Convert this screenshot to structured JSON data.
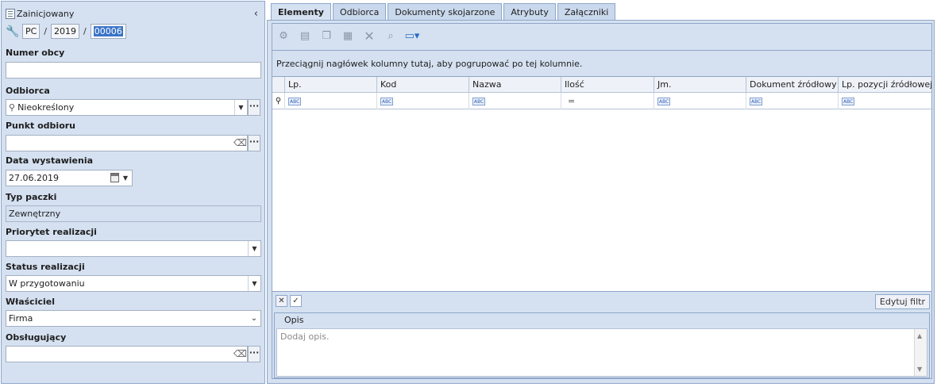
{
  "header": {
    "status": "Zainicjowany",
    "collapse_glyph": "‹",
    "number": {
      "prefix": "PC",
      "year": "2019",
      "seq": "00006",
      "sep": "/"
    }
  },
  "fields": {
    "numer_obcy": {
      "label": "Numer obcy",
      "value": ""
    },
    "odbiorca": {
      "label": "Odbiorca",
      "value": "Nieokreślony"
    },
    "punkt_odbioru": {
      "label": "Punkt odbioru",
      "value": ""
    },
    "data_wystawienia": {
      "label": "Data wystawienia",
      "value": "27.06.2019"
    },
    "typ_paczki": {
      "label": "Typ paczki",
      "value": "Zewnętrzny"
    },
    "priorytet": {
      "label": "Priorytet realizacji",
      "value": ""
    },
    "status_realizacji": {
      "label": "Status realizacji",
      "value": "W przygotowaniu"
    },
    "wlasciciel": {
      "label": "Właściciel",
      "value": "Firma"
    },
    "obslugujacy": {
      "label": "Obsługujący",
      "value": ""
    }
  },
  "tabs": [
    "Elementy",
    "Odbiorca",
    "Dokumenty skojarzone",
    "Atrybuty",
    "Załączniki"
  ],
  "active_tab": "Elementy",
  "toolbar_icons": [
    "add-item-icon",
    "edit-item-icon",
    "copy-item-icon",
    "paste-item-icon",
    "delete-icon",
    "search-icon",
    "export-icon"
  ],
  "grid": {
    "group_hint": "Przeciągnij nagłówek kolumny tutaj, aby pogrupować po tej kolumnie.",
    "columns": [
      "Lp.",
      "Kod",
      "Nazwa",
      "Ilość",
      "Jm.",
      "Dokument źródłowy",
      "Lp. pozycji źródłowej"
    ],
    "filter_glyphs": [
      "ABC",
      "ABC",
      "ABC",
      "=",
      "ABC",
      "ABC",
      "ABC"
    ],
    "edit_filter_label": "Edytuj filtr"
  },
  "opis": {
    "title": "Opis",
    "placeholder": "Dodaj opis."
  },
  "colors": {
    "panel_bg": "#d5e1f1",
    "border": "#8fa6c8",
    "selection": "#3a74c8"
  }
}
